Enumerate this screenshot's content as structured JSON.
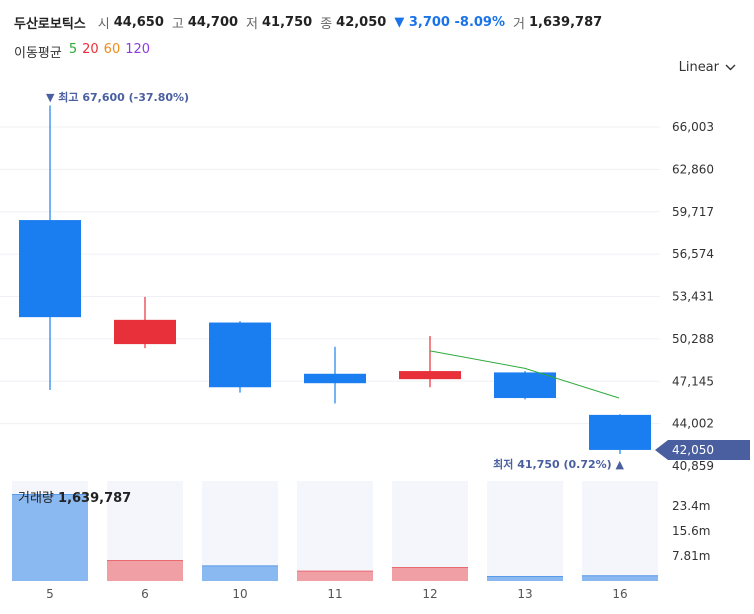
{
  "header": {
    "name": "두산로보틱스",
    "open_label": "시",
    "open": "44,650",
    "high_label": "고",
    "high": "44,700",
    "low_label": "저",
    "low": "41,750",
    "close_label": "종",
    "close": "42,050",
    "change": "▼ 3,700 -8.09%",
    "volume_label": "거",
    "volume": "1,639,787"
  },
  "moving_average": {
    "label": "이동평균",
    "periods": [
      {
        "value": "5",
        "color": "#2eaa3c"
      },
      {
        "value": "20",
        "color": "#e8303a"
      },
      {
        "value": "60",
        "color": "#f08c1a"
      },
      {
        "value": "120",
        "color": "#8a3ee0"
      }
    ]
  },
  "scale_selector": {
    "label": "Linear"
  },
  "annotations": {
    "high_marker": "▼ 최고 67,600 (-37.80%)",
    "low_marker": "최저 41,750 (0.72%) ▲",
    "last_price": "42,050"
  },
  "volume_panel": {
    "label": "거래량",
    "value": "1,639,787"
  },
  "colors": {
    "up": "#e8303a",
    "down": "#1a7ef0",
    "ma5": "#2eaa3c",
    "accent": "#4a5fa0"
  },
  "chart_data": {
    "type": "candlestick",
    "categories": [
      "5",
      "6",
      "10",
      "11",
      "12",
      "13",
      "16"
    ],
    "candles": [
      {
        "x": "5",
        "open": 59100,
        "high": 67600,
        "low": 46500,
        "close": 51900
      },
      {
        "x": "6",
        "open": 49900,
        "high": 53400,
        "low": 49600,
        "close": 51700
      },
      {
        "x": "10",
        "open": 51500,
        "high": 51600,
        "low": 46300,
        "close": 46700
      },
      {
        "x": "11",
        "open": 47700,
        "high": 49700,
        "low": 45500,
        "close": 47000
      },
      {
        "x": "12",
        "open": 47300,
        "high": 50500,
        "low": 46700,
        "close": 47900
      },
      {
        "x": "13",
        "open": 47800,
        "high": 47900,
        "low": 45800,
        "close": 45900
      },
      {
        "x": "16",
        "open": 44650,
        "high": 44700,
        "low": 41750,
        "close": 42050
      }
    ],
    "ma5": {
      "x": [
        "12",
        "13",
        "16"
      ],
      "values": [
        49400,
        48100,
        45900
      ]
    },
    "price_axis": {
      "ticks": [
        "66,003",
        "62,860",
        "59,717",
        "56,574",
        "53,431",
        "50,288",
        "47,145",
        "44,002",
        "40,859"
      ],
      "tick_values": [
        66003,
        62860,
        59717,
        56574,
        53431,
        50288,
        47145,
        44002,
        40859
      ],
      "range": [
        40859,
        66003
      ]
    },
    "volume": {
      "values": [
        27000000,
        6400000,
        4700000,
        3100000,
        4200000,
        1400000,
        1639787
      ],
      "directions": [
        "down",
        "up",
        "down",
        "up",
        "up",
        "down",
        "down"
      ],
      "ticks": [
        "23.4m",
        "15.6m",
        "7.81m"
      ],
      "tick_values": [
        23400000,
        15600000,
        7810000
      ],
      "max": 31200000
    },
    "grid": true
  }
}
